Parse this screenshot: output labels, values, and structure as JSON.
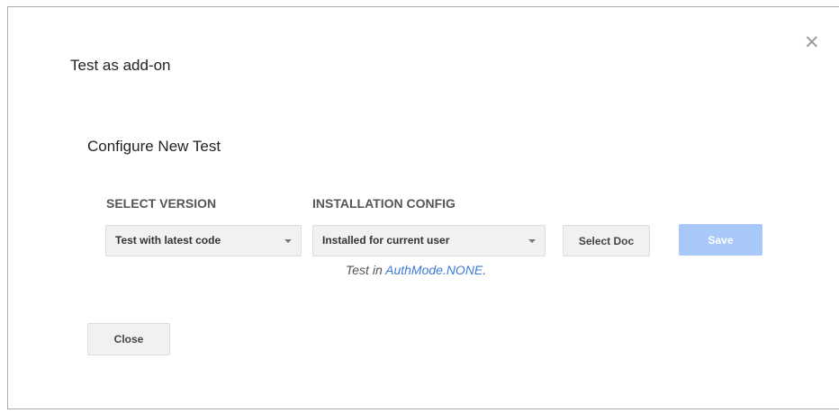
{
  "dialog": {
    "title": "Test as add-on",
    "close_icon": "close-icon",
    "section_title": "Configure New Test",
    "select_version": {
      "label": "SELECT VERSION",
      "selected": "Test with latest code"
    },
    "installation_config": {
      "label": "INSTALLATION CONFIG",
      "selected": "Installed for current user"
    },
    "select_doc_label": "Select Doc",
    "save_label": "Save",
    "auth_note": {
      "prefix": "Test in ",
      "link": "AuthMode.NONE",
      "suffix": "."
    },
    "close_label": "Close"
  },
  "colors": {
    "save_button_bg": "#a8c8f9",
    "link": "#3a7bd5",
    "button_bg": "#f1f1f1"
  }
}
